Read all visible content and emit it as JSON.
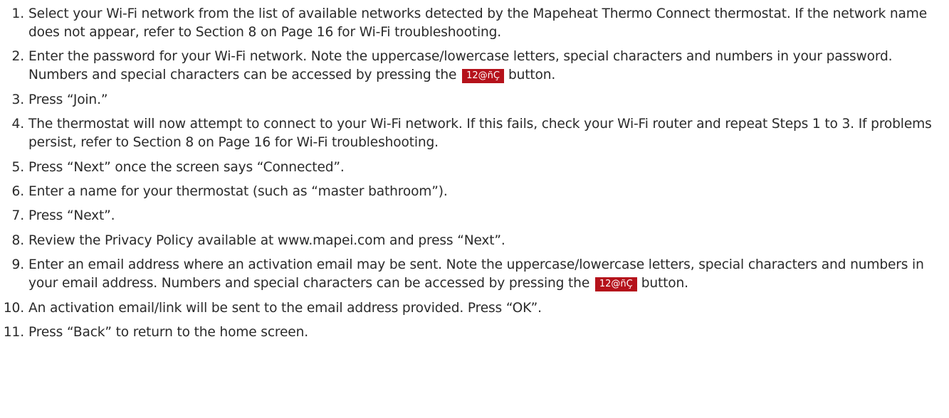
{
  "badge_label": "12@ñÇ",
  "steps": [
    {
      "num": "1.",
      "text": "Select your Wi-Fi network from the list of available networks detected by the Mapeheat Thermo Connect thermostat. If the network name does not appear, refer to Section 8 on Page 16 for Wi-Fi troubleshooting."
    },
    {
      "num": "2.",
      "text": "Enter the password for your Wi-Fi network. Note the uppercase/lowercase letters, special characters and numbers in your password. Numbers and special characters can be accessed by pressing the",
      "after": "button."
    },
    {
      "num": "3.",
      "text": "Press “Join.”"
    },
    {
      "num": "4.",
      "text": "The thermostat will now attempt to connect to your Wi-Fi network. If this fails, check your Wi-Fi router and repeat Steps 1 to 3. If problems persist, refer to Section 8 on Page 16 for Wi-Fi troubleshooting."
    },
    {
      "num": "5.",
      "text": "Press “Next” once the screen says “Connected”."
    },
    {
      "num": "6.",
      "text": "Enter a name for your thermostat (such as “master bathroom”)."
    },
    {
      "num": "7.",
      "text": "Press “Next”."
    },
    {
      "num": "8.",
      "text": "Review the Privacy Policy available at www.mapei.com and press “Next”."
    },
    {
      "num": "9.",
      "text": "Enter an email address where an activation email may be sent.  Note the uppercase/lowercase letters, special characters and numbers in your email address. Numbers and special characters can be accessed by pressing the",
      "after": "button."
    },
    {
      "num": "10.",
      "text": "An activation email/link will be sent to the email address provided. Press “OK”."
    },
    {
      "num": "11.",
      "text": "Press “Back” to return to the home screen."
    }
  ]
}
